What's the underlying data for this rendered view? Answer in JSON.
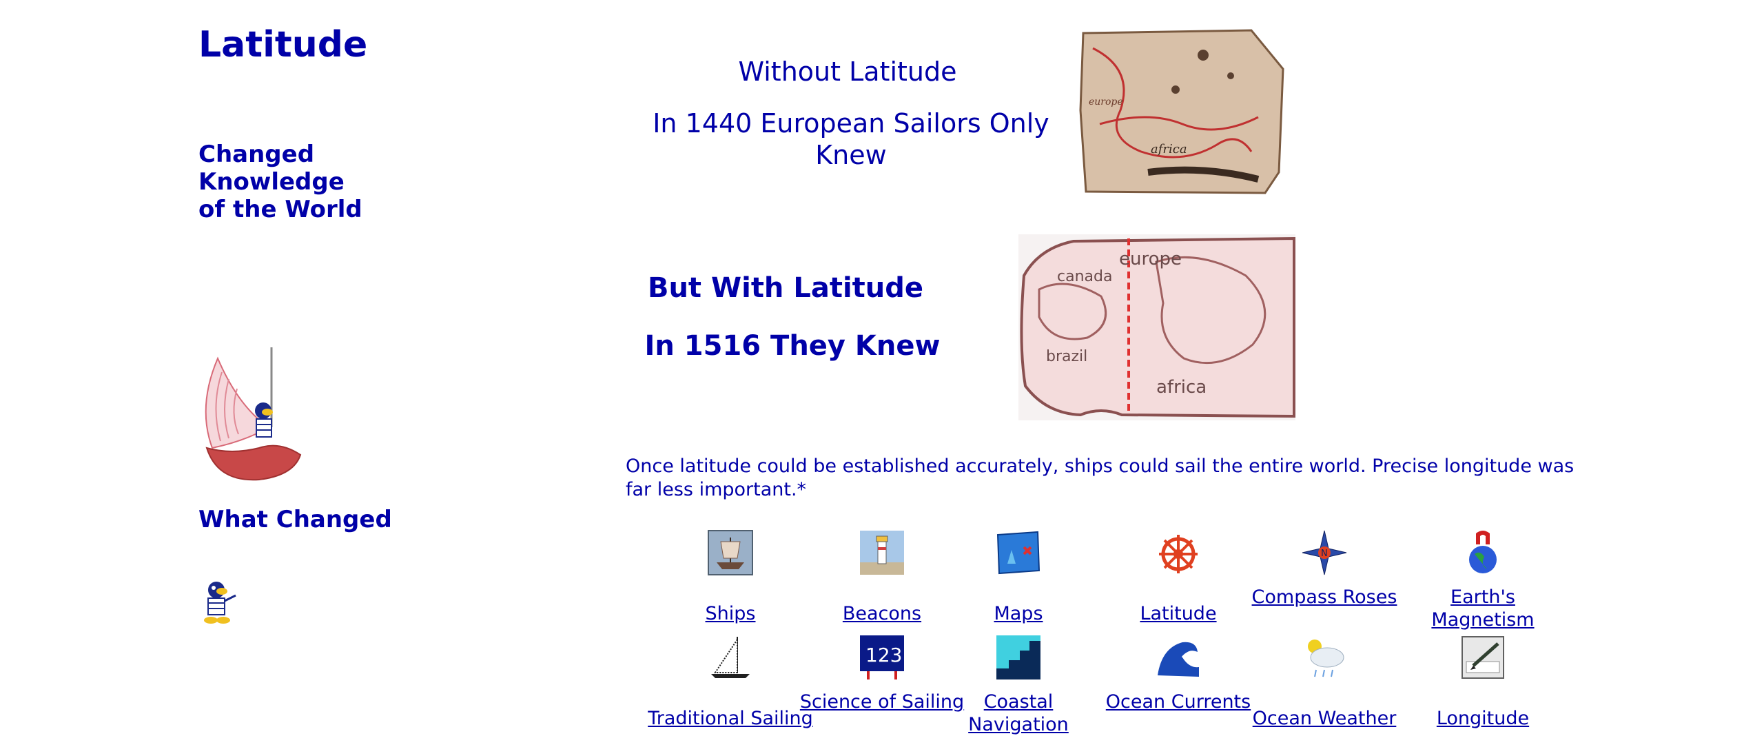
{
  "page": {
    "title": "Latitude",
    "subtitle": "Changed Knowledge of the World",
    "what_changed": "What Changed"
  },
  "headings": {
    "without": "Without Latitude",
    "in_1440": "In 1440 European Sailors Only Knew",
    "with": "But With Latitude",
    "in_1516": "In 1516 They Knew"
  },
  "map_labels": {
    "map1440": [
      "europe",
      "africa"
    ],
    "map1516": [
      "canada",
      "europe",
      "brazil",
      "africa"
    ]
  },
  "intro": "Once latitude could be established accurately, ships could sail the entire world. Precise longitude was far less important.*",
  "links_row1": [
    {
      "label": "Ships",
      "icon": "ship-picture-icon"
    },
    {
      "label": "Beacons",
      "icon": "lighthouse-icon"
    },
    {
      "label": "Maps",
      "icon": "treasure-map-icon"
    },
    {
      "label": "Latitude",
      "icon": "ship-wheel-icon"
    },
    {
      "label": "Compass Roses",
      "icon": "compass-rose-icon"
    },
    {
      "label": "Earth's Magnetism",
      "icon": "globe-magnet-icon"
    }
  ],
  "links_row2": [
    {
      "label": "Traditional Sailing",
      "icon": "sailboat-icon"
    },
    {
      "label": "Science of Sailing",
      "icon": "numbers-board-icon"
    },
    {
      "label": "Coastal Navigation",
      "icon": "coastline-icon"
    },
    {
      "label": "Ocean Currents",
      "icon": "wave-icon"
    },
    {
      "label": "Ocean Weather",
      "icon": "cloud-sun-icon"
    },
    {
      "label": "Longitude",
      "icon": "pen-paper-icon"
    }
  ],
  "colors": {
    "text": "#0000a8",
    "background": "#ffffff",
    "map_line": "#d83030",
    "ship_hull": "#c84040"
  }
}
